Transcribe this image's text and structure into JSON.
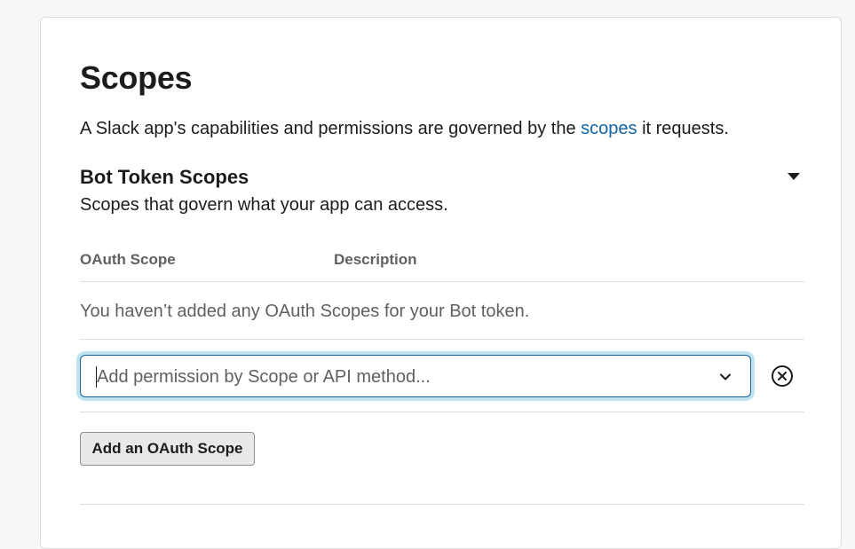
{
  "scopes_section": {
    "title": "Scopes",
    "intro": {
      "before_link": "A Slack app's capabilities and permissions are governed by the ",
      "link_text": "scopes",
      "after_link": " it requests."
    },
    "bot_token": {
      "title": "Bot Token Scopes",
      "description": "Scopes that govern what your app can access.",
      "collapse_icon": "caret-down-icon",
      "columns": [
        "OAuth Scope",
        "Description"
      ],
      "empty_message": "You haven’t added any OAuth Scopes for your Bot token.",
      "scope_select": {
        "value": "",
        "placeholder": "Add permission by Scope or API method...",
        "dropdown_icon": "chevron-down-icon",
        "clear_icon": "close-circle-icon"
      },
      "add_button_label": "Add an OAuth Scope"
    }
  },
  "colors": {
    "link": "#1264a3",
    "focus_ring": "#1d9bd1",
    "muted_text": "#616061",
    "button_bg": "#e8e8e8"
  }
}
